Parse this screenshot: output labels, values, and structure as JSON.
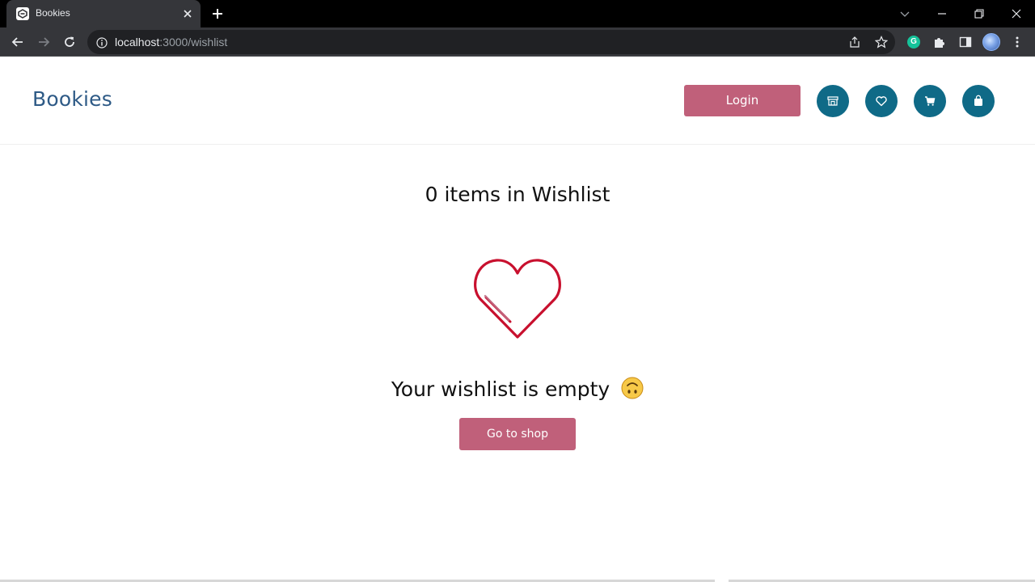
{
  "browser": {
    "tab_title": "Bookies",
    "url_host": "localhost",
    "url_path": ":3000/wishlist",
    "extension_badge": "G"
  },
  "header": {
    "brand": "Bookies",
    "login_label": "Login",
    "icons": [
      "store-icon",
      "heart-icon",
      "cart-icon",
      "bag-icon"
    ]
  },
  "main": {
    "count_text": "0 items in Wishlist",
    "empty_message": "Your wishlist is empty",
    "empty_emoji": "upside-down-face",
    "shop_button_label": "Go to shop"
  },
  "colors": {
    "brand": "#2e5a86",
    "button_pink": "#c0607a",
    "icon_teal": "#0f6a87",
    "heart_red": "#c8102e"
  }
}
